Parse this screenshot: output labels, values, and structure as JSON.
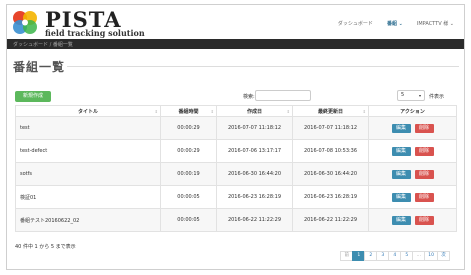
{
  "brand": {
    "title": "PISTA",
    "subtitle": "field tracking solution"
  },
  "nav": {
    "dashboard": "ダッシュボード",
    "programs": "番組 ⌄",
    "user": "IMPACTTV 様 ⌄"
  },
  "breadcrumb": "ダッシュボード / 番組一覧",
  "page_title": "番組一覧",
  "controls": {
    "new_button": "新規作成",
    "search_label": "検索:",
    "search_value": "",
    "per_page": "5",
    "per_page_label": "件表示"
  },
  "table": {
    "headers": [
      "タイトル",
      "番組時間",
      "作成日",
      "最終更新日",
      "アクション"
    ],
    "edit_label": "編集",
    "delete_label": "削除",
    "rows": [
      {
        "title": "test",
        "duration": "00:00:29",
        "created": "2016-07-07 11:18:12",
        "updated": "2016-07-07 11:18:12"
      },
      {
        "title": "test-defect",
        "duration": "00:00:29",
        "created": "2016-07-06 13:17:17",
        "updated": "2016-07-08 10:53:36"
      },
      {
        "title": "sotfs",
        "duration": "00:00:19",
        "created": "2016-06-30 16:44:20",
        "updated": "2016-06-30 16:44:20"
      },
      {
        "title": "検証01",
        "duration": "00:00:05",
        "created": "2016-06-23 16:28:19",
        "updated": "2016-06-23 16:28:19"
      },
      {
        "title": "番組テスト20160622_02",
        "duration": "00:00:05",
        "created": "2016-06-22 11:22:29",
        "updated": "2016-06-22 11:22:29"
      }
    ]
  },
  "info": "40 件中 1 から 5 まで表示",
  "pagination": [
    "前",
    "1",
    "2",
    "3",
    "4",
    "5",
    "…",
    "10",
    "次"
  ]
}
